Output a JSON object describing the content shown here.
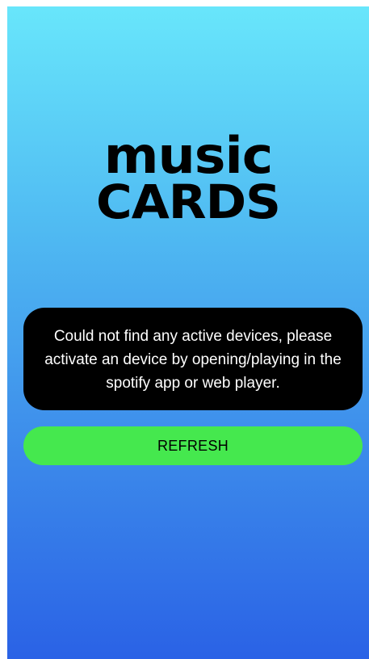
{
  "logo": {
    "line1": "music",
    "line2": "CARDS"
  },
  "message": {
    "text": "Could not find any active devices, please activate an device by opening/playing in the spotify app or web player."
  },
  "actions": {
    "refresh_label": "REFRESH"
  },
  "colors": {
    "gradient_top": "#68e6fb",
    "gradient_bottom": "#2a62e6",
    "message_bg": "#000000",
    "refresh_bg": "#45e84e"
  }
}
